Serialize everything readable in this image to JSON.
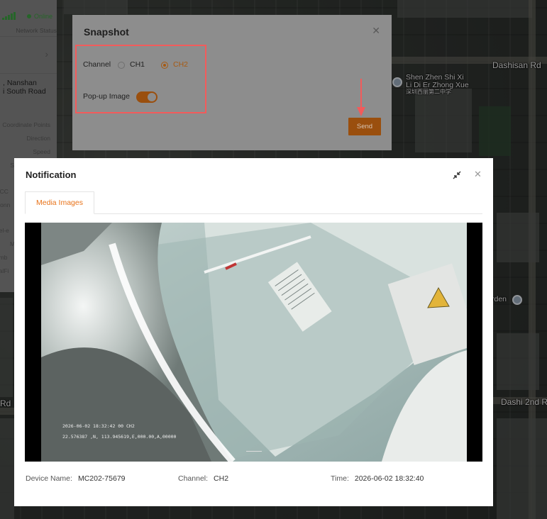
{
  "left_panel": {
    "status": "Online",
    "network_status_label": "Network Status",
    "address_line1": ", Nanshan",
    "address_line2": "i South Road",
    "fields": [
      "Coordinate Points",
      "Direction",
      "Speed",
      "S",
      "ACC",
      "Conn",
      "nel-e",
      "M",
      "umb",
      "nalFi"
    ]
  },
  "map": {
    "labels": {
      "dashisan_rd": "Dashisan Rd",
      "school_line1": "Shen Zhen Shi Xi",
      "school_line2": "Li Di Er Zhong Xue",
      "school_line3": "深圳西丽第二中学",
      "garden": "rden",
      "dashi_2nd": "Dashi 2nd R",
      "rd_left": "Rd"
    }
  },
  "snapshot_dialog": {
    "title": "Snapshot",
    "close_icon": "close-icon",
    "channel_label": "Channel",
    "channels": [
      "CH1",
      "CH2"
    ],
    "selected_channel": "CH2",
    "popup_image_label": "Pop-up Image",
    "popup_image_enabled": true,
    "send_label": "Send",
    "accent_color": "#e8731a",
    "highlight_color": "#f25b5b"
  },
  "notification": {
    "title": "Notification",
    "minimize_icon": "compress-icon",
    "close_icon": "close-icon",
    "tabs": [
      "Media Images"
    ],
    "active_tab": "Media Images",
    "image_overlay": {
      "line1": "2026-06-02 18:32:42 00 CH2",
      "line2": "22.576387 ,N, 113.945619,E,000.00,A,00000"
    },
    "device_name_label": "Device Name:",
    "device_name_value": "MC202-75679",
    "channel_label": "Channel:",
    "channel_value": "CH2",
    "time_label": "Time:",
    "time_value": "2026-06-02 18:32:40"
  }
}
